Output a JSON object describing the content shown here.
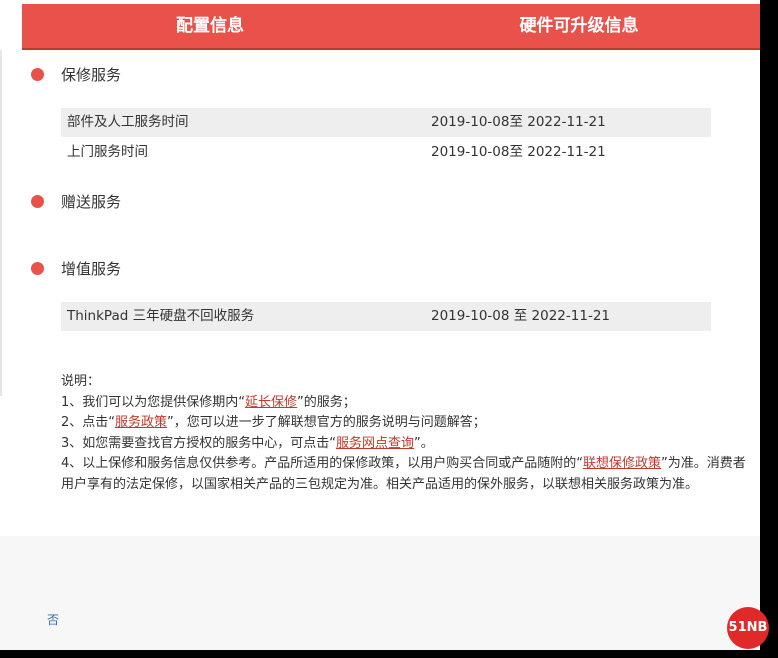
{
  "tabs": [
    {
      "label": "配置信息"
    },
    {
      "label": "硬件可升级信息"
    }
  ],
  "sections": [
    {
      "title": "保修服务",
      "rows": [
        {
          "name": "部件及人工服务时间",
          "period": "2019-10-08至   2022-11-21"
        },
        {
          "name": "上门服务时间",
          "period": "2019-10-08至   2022-11-21"
        }
      ]
    },
    {
      "title": "赠送服务",
      "rows": []
    },
    {
      "title": "增值服务",
      "rows": [
        {
          "name": "ThinkPad 三年硬盘不回收服务",
          "period": "2019-10-08 至 2022-11-21"
        }
      ]
    }
  ],
  "notes": {
    "heading": "说明：",
    "line1_pre": "1、我们可以为您提供保修期内“",
    "line1_link": "延长保修",
    "line1_post": "”的服务；",
    "line2_pre": "2、点击“",
    "line2_link": "服务政策",
    "line2_post": "”，您可以进一步了解联想官方的服务说明与问题解答；",
    "line3_pre": "3、如您需要查找官方授权的服务中心，可点击“",
    "line3_link": "服务网点查询",
    "line3_post": "”。",
    "line4_pre": "4、以上保修和服务信息仅供参考。产品所适用的保修政策，以用户购买合同或产品随附的“",
    "line4_link": "联想保修政策",
    "line4_post": "”为准。消费者用户享有的法定保修，以国家相关产品的三包规定为准。相关产品适用的保外服务，以联想相关服务政策为准。"
  },
  "footer": {
    "no_link": "否",
    "logo_text": "51NB"
  },
  "colors": {
    "accent": "#e8524a",
    "link": "#c0392b"
  }
}
